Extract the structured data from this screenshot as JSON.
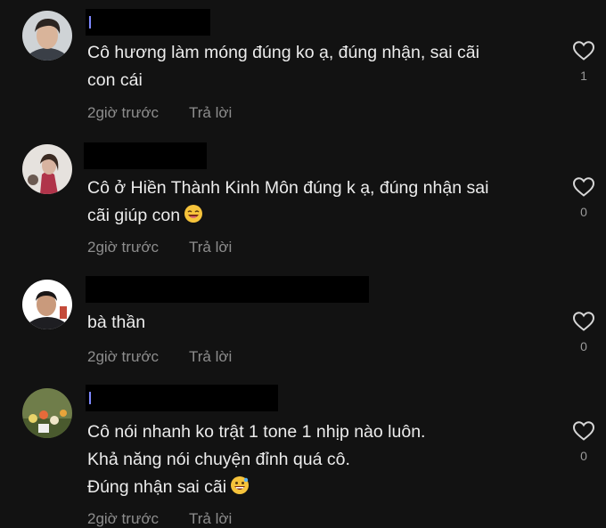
{
  "comments": [
    {
      "text": "Cô hương làm móng đúng ko ạ, đúng nhận, sai cãi\ncon cái",
      "time": "2giờ trước",
      "reply_label": "Trả lời",
      "likes": "1",
      "avatar_icon": "person-avatar-icon"
    },
    {
      "text": "Cô ở Hiền Thành Kinh Môn đúng k ạ, đúng nhận sai\ncãi giúp con",
      "emoji": "laughing-emoji-icon",
      "time": "2giờ trước",
      "reply_label": "Trả lời",
      "likes": "0",
      "avatar_icon": "person-avatar-icon"
    },
    {
      "text": "bà thần",
      "time": "2giờ trước",
      "reply_label": "Trả lời",
      "likes": "0",
      "avatar_icon": "person-avatar-icon"
    },
    {
      "text": "Cô nói nhanh ko trật 1 tone 1 nhịp nào luôn.\nKhả năng nói chuyện đỉnh quá cô.\nĐúng nhận sai cãi",
      "emoji": "grinning-emoji-icon",
      "time": "2giờ trước",
      "reply_label": "Trả lời",
      "likes": "0",
      "avatar_icon": "flowers-avatar-icon"
    }
  ],
  "colors": {
    "background": "#121212",
    "text": "#ececec",
    "meta": "#8d8d8d",
    "redaction": "#000000"
  }
}
